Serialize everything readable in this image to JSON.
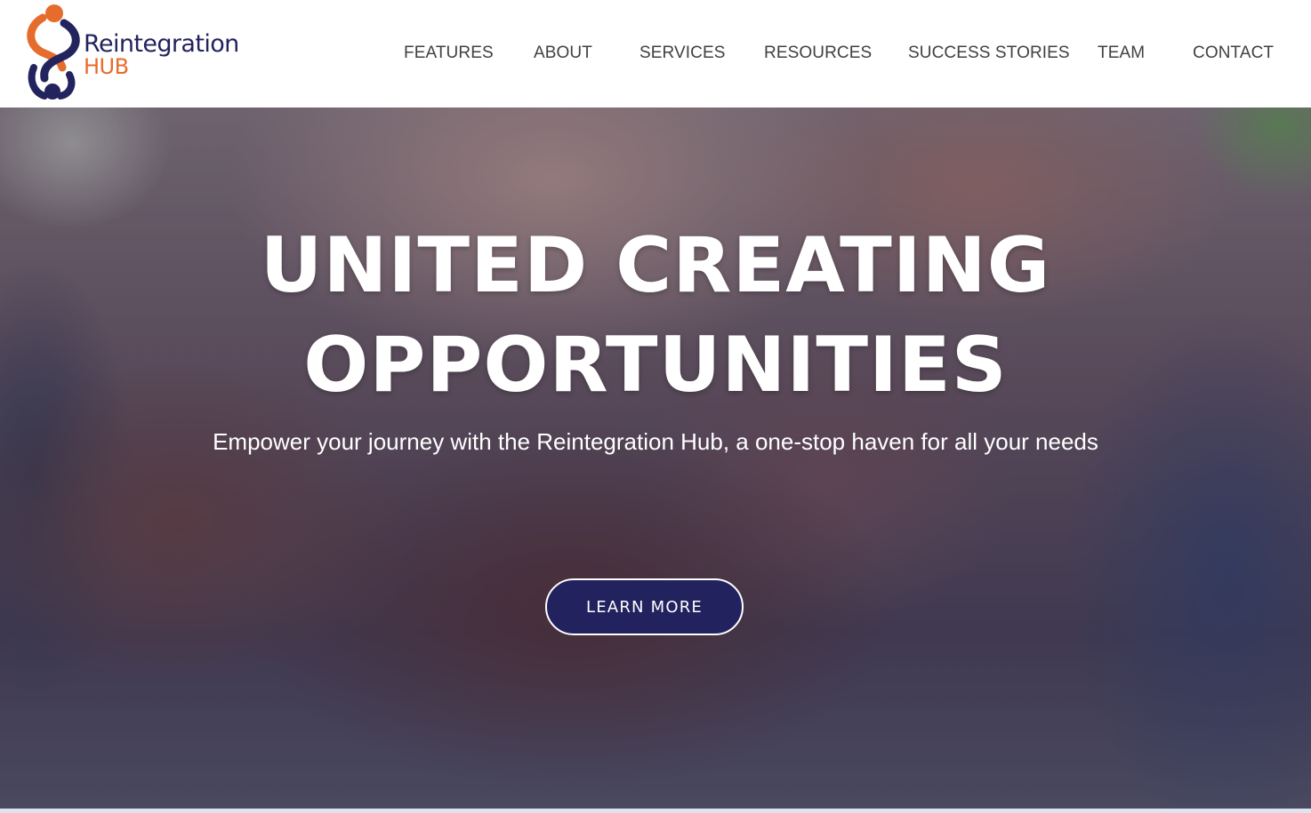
{
  "brand": {
    "name_line1": "Reintegration",
    "name_line2": "HUB",
    "primary_color": "#23235e",
    "accent_color": "#e66c2c"
  },
  "nav": {
    "items": [
      {
        "label": "FEATURES"
      },
      {
        "label": "ABOUT"
      },
      {
        "label": "SERVICES"
      },
      {
        "label": "RESOURCES"
      },
      {
        "label": "SUCCESS STORIES"
      },
      {
        "label": "TEAM"
      },
      {
        "label": "CONTACT"
      }
    ]
  },
  "hero": {
    "title_line1": "UNITED CREATING",
    "title_line2": "OPPORTUNITIES",
    "subtitle": "Empower your journey with the Reintegration Hub, a one-stop haven for all your needs",
    "cta_label": "LEARN MORE",
    "cta_color": "#22225f"
  }
}
